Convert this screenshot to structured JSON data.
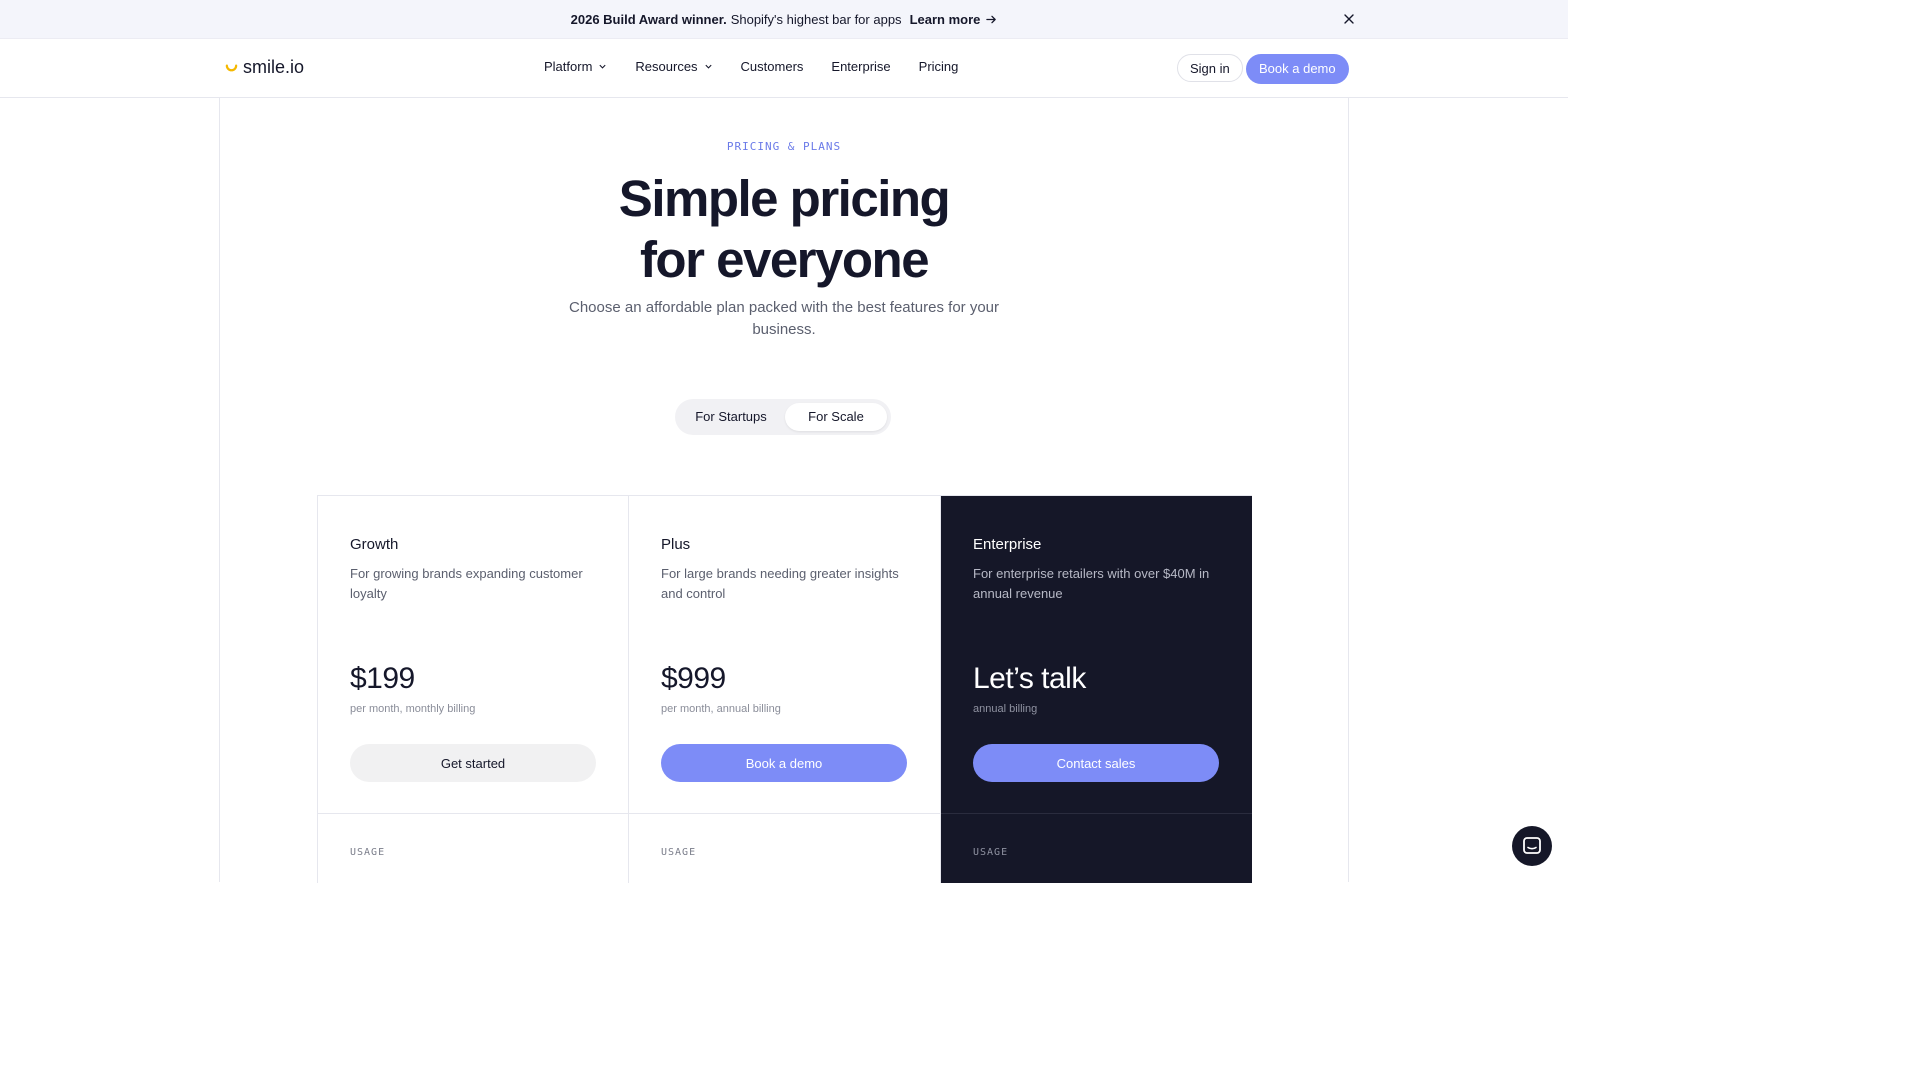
{
  "announcement": {
    "bold_text": "2026 Build Award winner.",
    "text": "Shopify's highest bar for apps",
    "link_label": "Learn more"
  },
  "header": {
    "logo_text": "smile.io",
    "nav": [
      {
        "label": "Platform",
        "has_dropdown": true
      },
      {
        "label": "Resources",
        "has_dropdown": true
      },
      {
        "label": "Customers",
        "has_dropdown": false
      },
      {
        "label": "Enterprise",
        "has_dropdown": false
      },
      {
        "label": "Pricing",
        "has_dropdown": false
      }
    ],
    "sign_in_label": "Sign in",
    "book_demo_label": "Book a demo"
  },
  "hero": {
    "eyebrow": "PRICING & PLANS",
    "title_line1": "Simple pricing",
    "title_line2": "for everyone",
    "subtitle": "Choose an affordable plan packed with the best features for your business."
  },
  "toggle": {
    "options": [
      "For Startups",
      "For Scale"
    ],
    "selected": "For Scale"
  },
  "plans": [
    {
      "name": "Growth",
      "description": "For growing brands expanding customer loyalty",
      "price": "$199",
      "billing": "per month, monthly billing",
      "cta": "Get started",
      "section_label": "USAGE"
    },
    {
      "name": "Plus",
      "description": "For large brands needing greater insights and control",
      "price": "$999",
      "billing": "per month, annual billing",
      "cta": "Book a demo",
      "section_label": "USAGE"
    },
    {
      "name": "Enterprise",
      "description": "For enterprise retailers with over $40M in annual revenue",
      "price": "Let’s talk",
      "billing": "annual billing",
      "cta": "Contact sales",
      "section_label": "USAGE"
    }
  ],
  "colors": {
    "accent": "#7d8cf7",
    "eyebrow": "#6a7ae8",
    "dark_card": "#151728",
    "text": "#15172a",
    "logo_smile": "#f5b800"
  },
  "icons": {
    "announcement_arrow": "arrow-right-icon",
    "announcement_close": "close-icon",
    "logo": "smile-logo-icon",
    "nav_dropdown": "chevron-down-icon",
    "chat": "chat-bubble-icon"
  }
}
